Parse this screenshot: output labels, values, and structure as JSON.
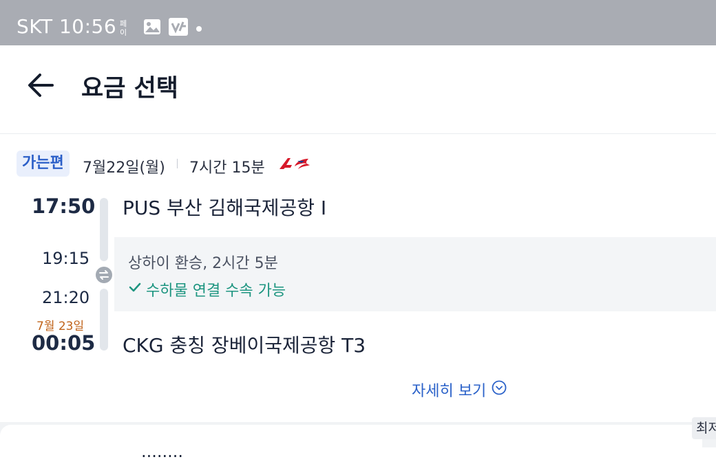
{
  "status_bar": {
    "carrier_time": "SKT 10:56",
    "icons": [
      "pay-icon",
      "gallery-icon",
      "vpn-icon",
      "dot-icon"
    ]
  },
  "header": {
    "back_icon": "arrow-left-icon",
    "title": "요금 선택"
  },
  "journey": {
    "direction_badge": "가는편",
    "date": "7월22일(월)",
    "total_duration": "7시간 15분",
    "airline_logo": "china-eastern-logo",
    "departure_time": "17:50",
    "departure_airport": "PUS  부산 김해국제공항 I",
    "layover_arrival_time": "19:15",
    "layover_departure_time": "21:20",
    "layover_info": "상하이 환승, 2시간 5분",
    "baggage_note": "수하물 연결 수속 가능",
    "arrival_date": "7월 23일",
    "arrival_time": "00:05",
    "arrival_airport": "CKG  충칭 장베이국제공항 T3",
    "details_link": "자세히 보기",
    "colors": {
      "accent": "#2b62c9",
      "success": "#1d9580",
      "date_warning": "#c0631a"
    }
  },
  "footer": {
    "lowest_price_chip": "최저",
    "next_card_text": "········"
  }
}
